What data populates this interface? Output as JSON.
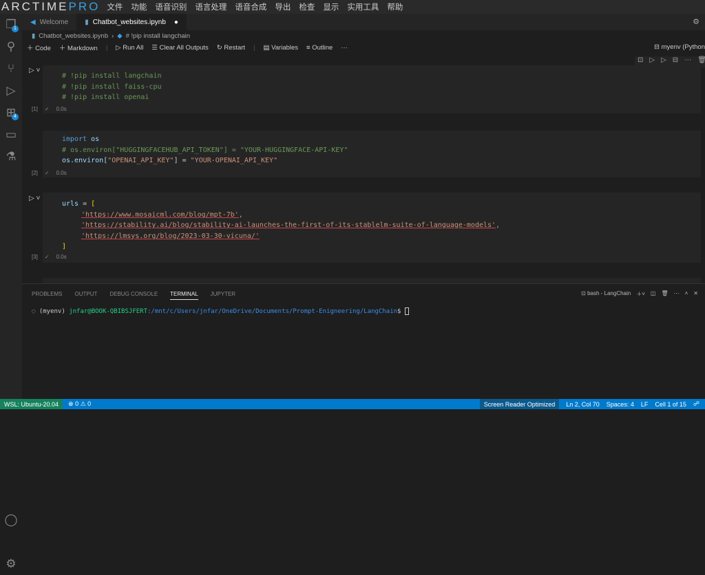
{
  "app": {
    "logo_main": "ARCTIME",
    "logo_pro": "PRO",
    "menu": [
      "文件",
      "功能",
      "语音识别",
      "语言处理",
      "语音合成",
      "导出",
      "检查",
      "显示",
      "实用工具",
      "帮助"
    ]
  },
  "activity": {
    "explorer_badge": "1",
    "extensions_badge": "4"
  },
  "tabs": [
    {
      "label": "Welcome"
    },
    {
      "label": "Chatbot_websites.ipynb"
    }
  ],
  "breadcrumb": {
    "file": "Chatbot_websites.ipynb",
    "section": "# !pip install langchain"
  },
  "toolbar": {
    "code": "Code",
    "markdown": "Markdown",
    "run_all": "Run All",
    "clear": "Clear All Outputs",
    "restart": "Restart",
    "variables": "Variables",
    "outline": "Outline",
    "more": "···",
    "kernel": "myenv (Python"
  },
  "cells": [
    {
      "exec": "[1]",
      "time": "0.0s"
    },
    {
      "exec": "[2]",
      "time": "0.0s"
    },
    {
      "exec": "[3]",
      "time": "0.0s"
    }
  ],
  "code": {
    "c1": [
      "# !pip install langchain",
      "# !pip install faiss-cpu",
      "# !pip install openai"
    ],
    "c2_import": "import",
    "c2_os": "os",
    "c2_comment": "# os.environ[\"HUGGINGFACEHUB_API_TOKEN\"] = \"YOUR-HUGGINGFACE-API-KEY\"",
    "c2_l3a": "os.environ[",
    "c2_l3b": "\"OPENAI_API_KEY\"",
    "c2_l3c": "] = ",
    "c2_l3d": "\"YOUR-OPENAI_API_KEY\"",
    "c3_var": "urls",
    "c3_eq": " = ",
    "c3_open": "[",
    "c3_close": "]",
    "urls": [
      "'https://www.mosaicml.com/blog/mpt-7b'",
      "'https://stability.ai/blog/stability-ai-launches-the-first-of-its-stablelm-suite-of-language-models'",
      "'https://lmsys.org/blog/2023-03-30-vicuna/'"
    ]
  },
  "panel": {
    "tabs": [
      "PROBLEMS",
      "OUTPUT",
      "DEBUG CONSOLE",
      "TERMINAL",
      "JUPYTER"
    ],
    "shell": "bash - LangChain"
  },
  "terminal": {
    "env": "(myenv)",
    "user": "jnfar@BOOK-QBIBSJFERT",
    "path": ":/mnt/c/Users/jnfar/OneDrive/Documents/Prompt-Enigneering/LangChain",
    "prompt": "$"
  },
  "status": {
    "remote": "WSL: Ubuntu-20.04",
    "problems": "⊗ 0 ⚠ 0",
    "reader": "Screen Reader Optimized",
    "pos": "Ln 2, Col 70",
    "spaces": "Spaces: 4",
    "eol": "LF",
    "cell": "Cell 1 of 15"
  }
}
